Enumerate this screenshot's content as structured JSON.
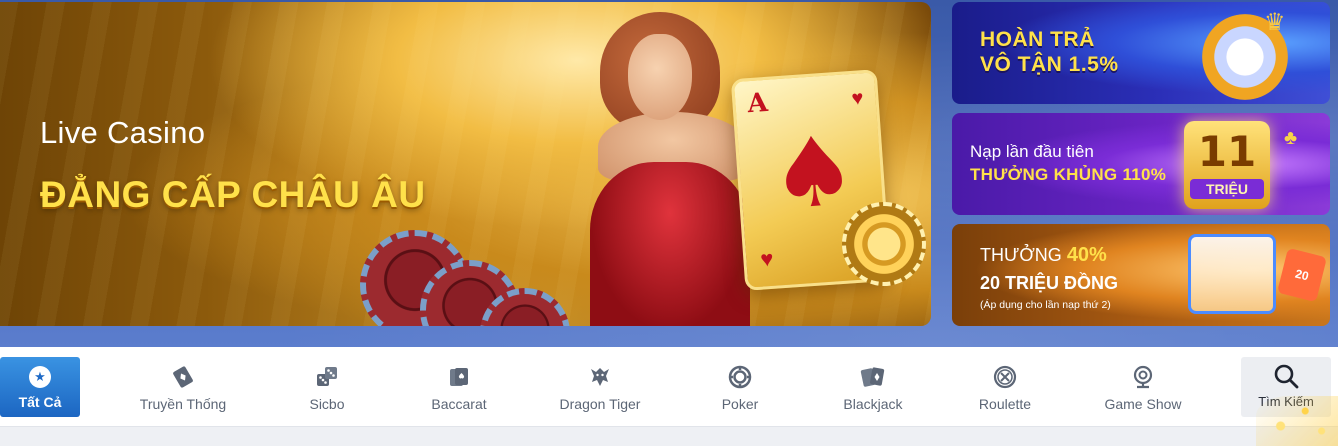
{
  "hero": {
    "title": "Live Casino",
    "subtitle": "ĐẲNG CẤP CHÂU ÂU",
    "card_rank": "A"
  },
  "promos": [
    {
      "line1": "HOÀN TRẢ",
      "line2": "VÔ TẬN 1.5%"
    },
    {
      "line1": "Nạp lần đầu tiên",
      "line2": "THƯỞNG KHỦNG 110%",
      "badge_number": "11",
      "badge_unit": "TRIỆU"
    },
    {
      "line1_prefix": "THƯỞNG ",
      "line1_value": "40%",
      "line2": "20 TRIỆU ĐỒNG",
      "line3": "(Áp dụng cho lần nạp thứ 2)",
      "ticket": "20"
    }
  ],
  "nav": {
    "active": {
      "label": "Tất Cả",
      "icon": "star-icon"
    },
    "items": [
      {
        "label": "Truyền Thống",
        "icon": "card-diamond-icon"
      },
      {
        "label": "Sicbo",
        "icon": "dice-icon"
      },
      {
        "label": "Baccarat",
        "icon": "baccarat-cards-icon"
      },
      {
        "label": "Dragon Tiger",
        "icon": "dragon-icon"
      },
      {
        "label": "Poker",
        "icon": "poker-chip-icon"
      },
      {
        "label": "Blackjack",
        "icon": "blackjack-cards-icon"
      },
      {
        "label": "Roulette",
        "icon": "roulette-icon"
      },
      {
        "label": "Game Show",
        "icon": "webcam-icon"
      }
    ],
    "search": {
      "label": "Tìm Kiếm",
      "icon": "search-icon"
    }
  },
  "colors": {
    "active_tab": "#1c66c2",
    "nav_text": "#5c6676",
    "highlight_yellow": "#ffe14a"
  }
}
